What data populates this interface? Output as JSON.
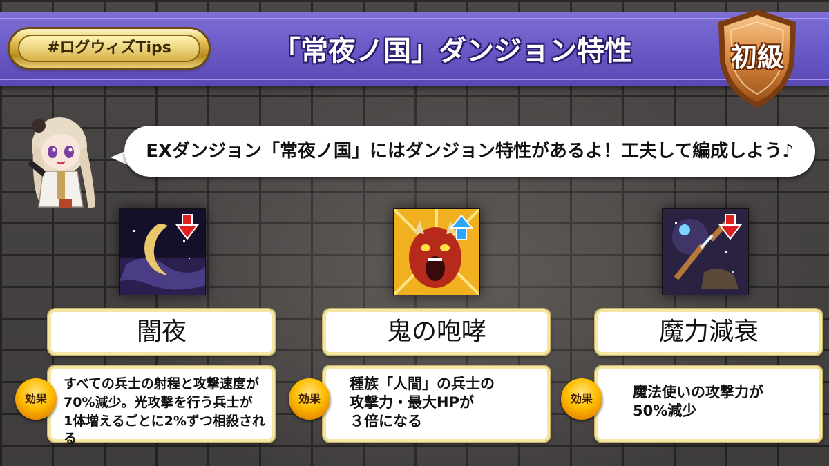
{
  "header": {
    "tag": "#ログウィズTips",
    "title": "「常夜ノ国」ダンジョン特性",
    "level_badge": "初級"
  },
  "speech": {
    "text": "EXダンジョン「常夜ノ国」にはダンジョン特性があるよ！工夫して編成しよう♪"
  },
  "traits": [
    {
      "name": "闇夜",
      "icon": "crescent-moon-night-icon",
      "arrow": "down",
      "effect_label": "効果",
      "effect_lines": [
        "すべての兵士の射程と攻撃速度が",
        "70%減少。光攻撃を行う兵士が",
        "1体増えるごとに2%ずつ相殺される"
      ]
    },
    {
      "name": "鬼の咆哮",
      "icon": "roaring-oni-icon",
      "arrow": "up",
      "effect_label": "効果",
      "effect_lines": [
        "種族「人間」の兵士の",
        "攻撃力・最大HPが",
        "３倍になる"
      ]
    },
    {
      "name": "魔力減衰",
      "icon": "broken-staff-magic-icon",
      "arrow": "down",
      "effect_label": "効果",
      "effect_lines": [
        "魔法使いの攻撃力が",
        "50%減少"
      ]
    }
  ],
  "colors": {
    "banner": "#6c5cc8",
    "arrow_down": "#e02020",
    "arrow_up": "#2aa7ff",
    "effect_badge": "#ffbd00"
  }
}
